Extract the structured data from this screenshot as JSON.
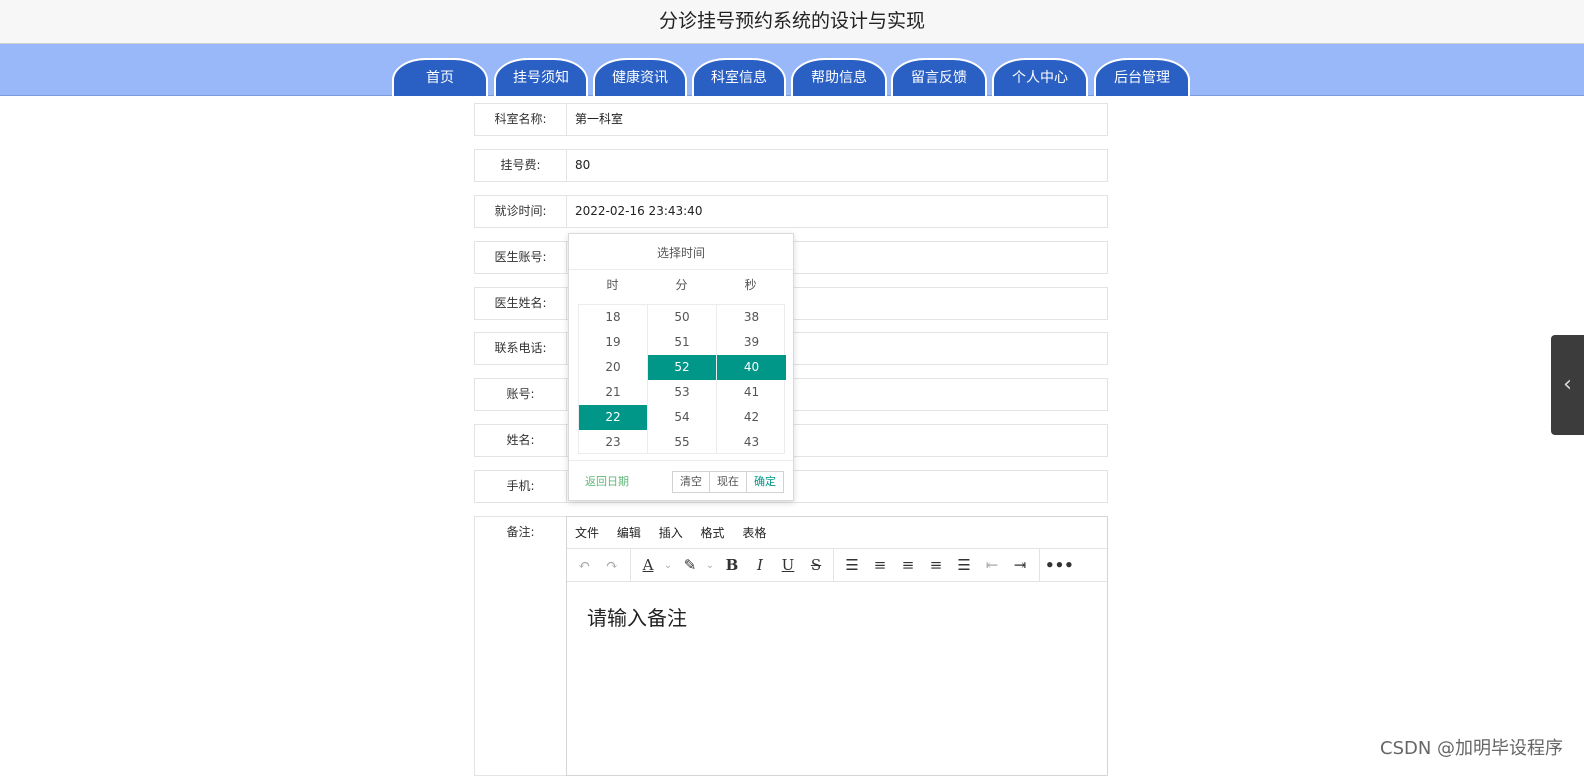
{
  "header": {
    "title": "分诊挂号预约系统的设计与实现"
  },
  "nav": [
    "首页",
    "挂号须知",
    "健康资讯",
    "科室信息",
    "帮助信息",
    "留言反馈",
    "个人中心",
    "后台管理"
  ],
  "form": {
    "department_label": "科室名称:",
    "department_value": "第一科室",
    "fee_label": "挂号费:",
    "fee_value": "80",
    "visit_time_label": "就诊时间:",
    "visit_time_value": "2022-02-16 23:43:40",
    "doctor_account_label": "医生账号:",
    "doctor_name_label": "医生姓名:",
    "phone_label": "联系电话:",
    "account_label": "账号:",
    "name_label": "姓名:",
    "mobile_label": "手机:",
    "notes_label": "备注:"
  },
  "editor": {
    "menus": [
      "文件",
      "编辑",
      "插入",
      "格式",
      "表格"
    ],
    "placeholder": "请输入备注"
  },
  "time_picker": {
    "title": "选择时间",
    "headers": [
      "时",
      "分",
      "秒"
    ],
    "hours": [
      "18",
      "19",
      "20",
      "21",
      "22",
      "23"
    ],
    "minutes": [
      "50",
      "51",
      "52",
      "53",
      "54",
      "55"
    ],
    "seconds": [
      "38",
      "39",
      "40",
      "41",
      "42",
      "43"
    ],
    "selected_hour": "22",
    "selected_minute": "52",
    "selected_second": "40",
    "back_label": "返回日期",
    "clear_label": "清空",
    "now_label": "现在",
    "confirm_label": "确定"
  },
  "watermark": "CSDN @加明毕设程序",
  "colors": {
    "nav_bg": "#98b8fa",
    "tab": "#2a5fc4",
    "selected": "#009688",
    "link": "#5fb878"
  }
}
